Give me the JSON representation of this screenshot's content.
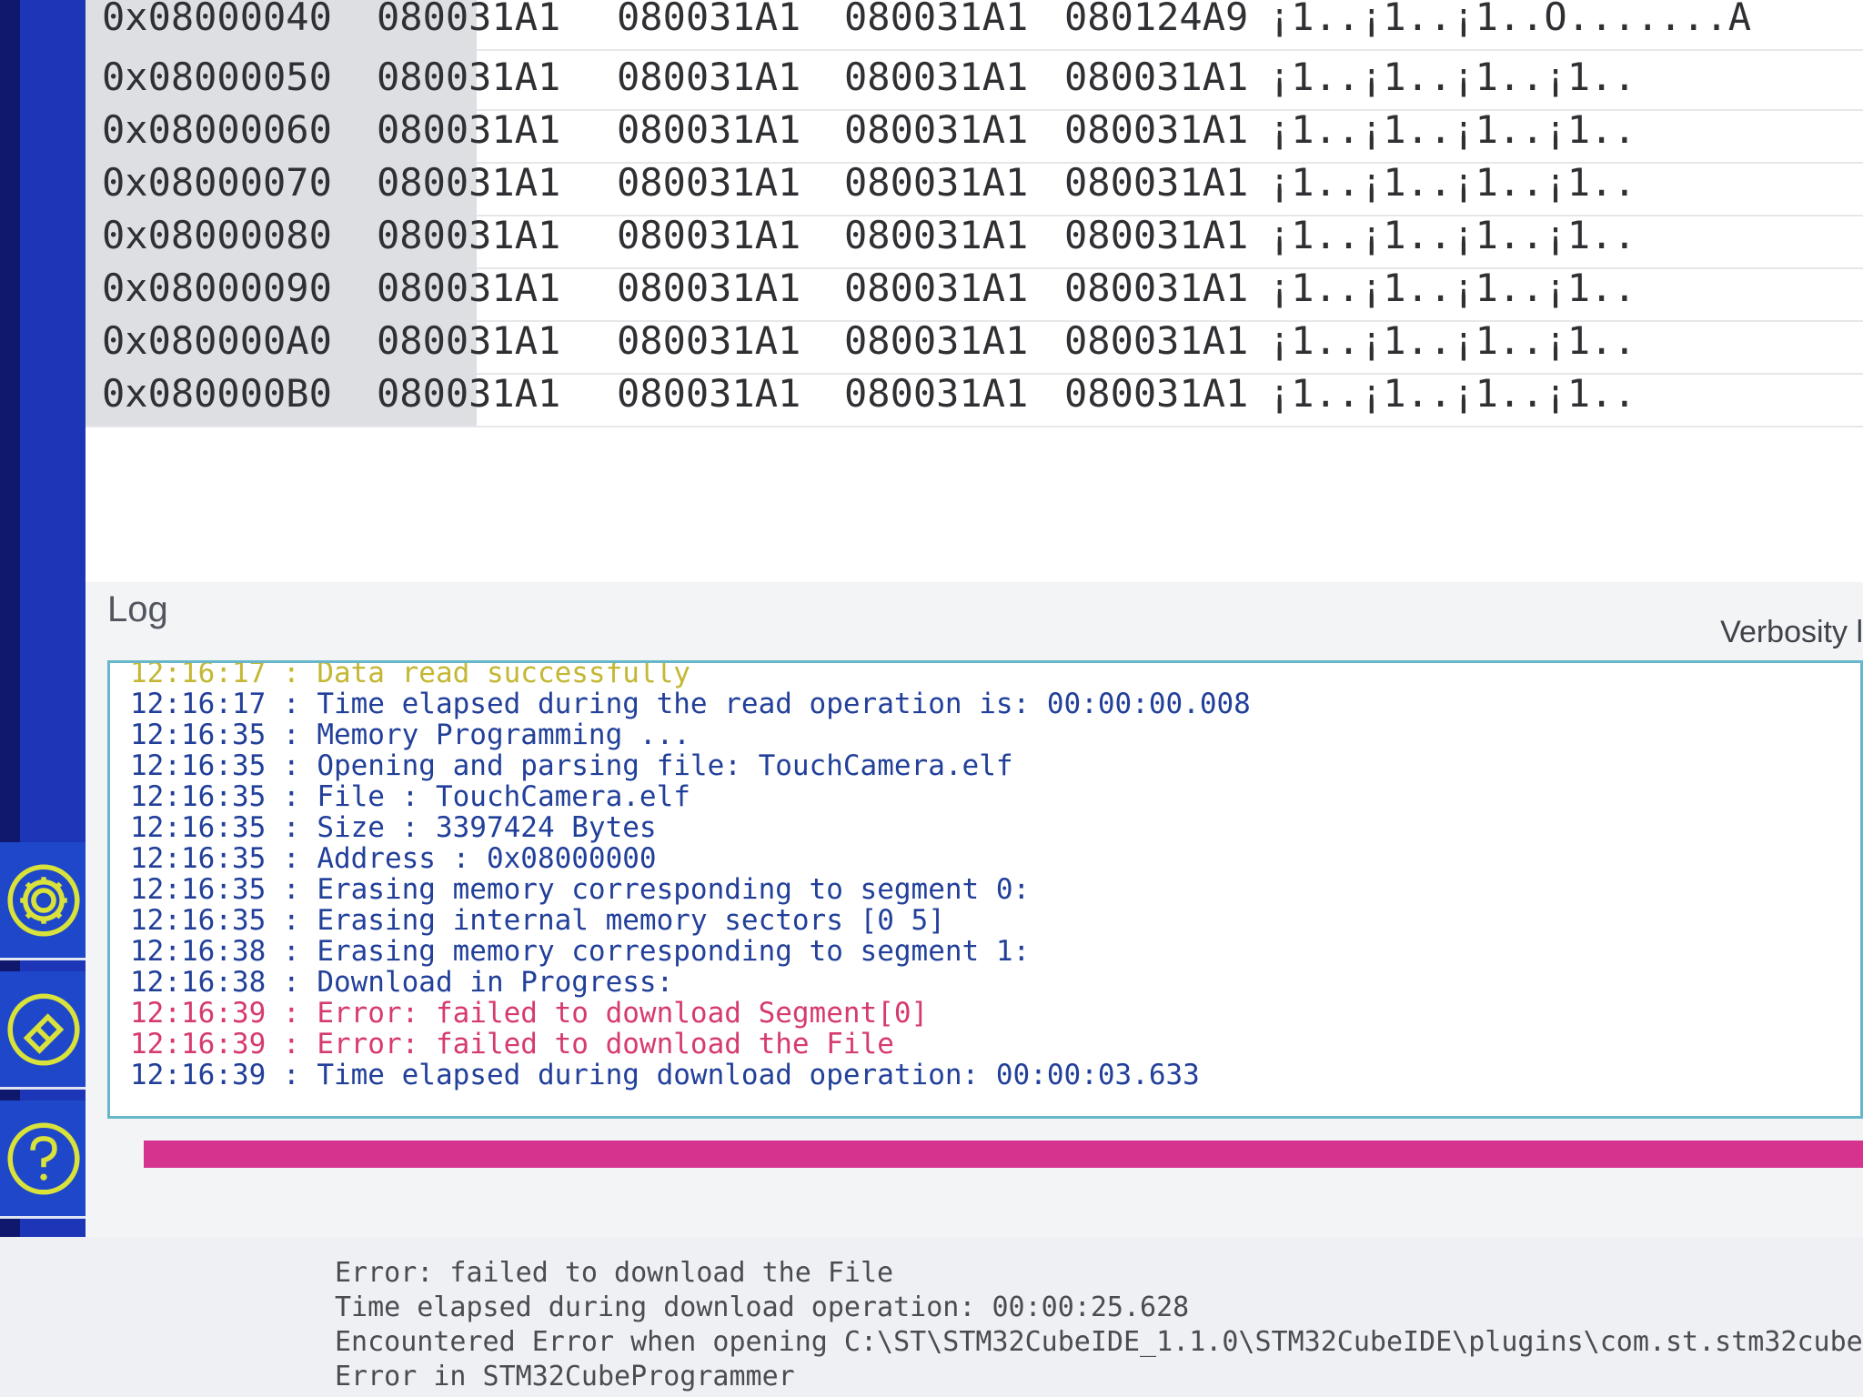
{
  "memory_table": {
    "rows": [
      {
        "address": "0x08000040",
        "words": [
          "080031A1",
          "080031A1",
          "080031A1",
          "080124A9"
        ],
        "ascii": "¡1..¡1..¡1..Ó.......A"
      },
      {
        "address": "0x08000050",
        "words": [
          "080031A1",
          "080031A1",
          "080031A1",
          "080031A1"
        ],
        "ascii": "¡1..¡1..¡1..¡1.."
      },
      {
        "address": "0x08000060",
        "words": [
          "080031A1",
          "080031A1",
          "080031A1",
          "080031A1"
        ],
        "ascii": "¡1..¡1..¡1..¡1.."
      },
      {
        "address": "0x08000070",
        "words": [
          "080031A1",
          "080031A1",
          "080031A1",
          "080031A1"
        ],
        "ascii": "¡1..¡1..¡1..¡1.."
      },
      {
        "address": "0x08000080",
        "words": [
          "080031A1",
          "080031A1",
          "080031A1",
          "080031A1"
        ],
        "ascii": "¡1..¡1..¡1..¡1.."
      },
      {
        "address": "0x08000090",
        "words": [
          "080031A1",
          "080031A1",
          "080031A1",
          "080031A1"
        ],
        "ascii": "¡1..¡1..¡1..¡1.."
      },
      {
        "address": "0x080000A0",
        "words": [
          "080031A1",
          "080031A1",
          "080031A1",
          "080031A1"
        ],
        "ascii": "¡1..¡1..¡1..¡1.."
      },
      {
        "address": "0x080000B0",
        "words": [
          "080031A1",
          "080031A1",
          "080031A1",
          "080031A1"
        ],
        "ascii": "¡1..¡1..¡1..¡1.."
      }
    ]
  },
  "log": {
    "title": "Log",
    "verbosity_label": "Verbosity l",
    "lines": [
      {
        "time": "12:16:17",
        "text": "Data read successfully",
        "level": "ok"
      },
      {
        "time": "12:16:17",
        "text": "Time elapsed during the read operation is: 00:00:00.008",
        "level": "info"
      },
      {
        "time": "12:16:35",
        "text": "Memory Programming ...",
        "level": "info"
      },
      {
        "time": "12:16:35",
        "text": "Opening and parsing file: TouchCamera.elf",
        "level": "info"
      },
      {
        "time": "12:16:35",
        "text": "File : TouchCamera.elf",
        "level": "info"
      },
      {
        "time": "12:16:35",
        "text": "Size : 3397424 Bytes",
        "level": "info"
      },
      {
        "time": "12:16:35",
        "text": "Address : 0x08000000",
        "level": "info"
      },
      {
        "time": "12:16:35",
        "text": "Erasing memory corresponding to segment 0:",
        "level": "info"
      },
      {
        "time": "12:16:35",
        "text": "Erasing internal memory sectors [0 5]",
        "level": "info"
      },
      {
        "time": "12:16:38",
        "text": "Erasing memory corresponding to segment 1:",
        "level": "info"
      },
      {
        "time": "12:16:38",
        "text": "Download in Progress:",
        "level": "info"
      },
      {
        "time": "12:16:39",
        "text": "Error: failed to download Segment[0]",
        "level": "err"
      },
      {
        "time": "12:16:39",
        "text": "Error: failed to download the File",
        "level": "err"
      },
      {
        "time": "12:16:39",
        "text": "Time elapsed during download operation: 00:00:03.633",
        "level": "info"
      }
    ]
  },
  "progress": {
    "value": 1.0,
    "color": "#d6338f"
  },
  "sidebar": {
    "icons": [
      {
        "name": "gear-icon"
      },
      {
        "name": "eraser-icon"
      },
      {
        "name": "help-icon"
      }
    ],
    "icon_color": "#d8e23a"
  },
  "console": {
    "lines": [
      "Error: failed to download the File",
      "Time elapsed during download operation: 00:00:25.628",
      "Encountered Error when opening C:\\ST\\STM32CubeIDE_1.1.0\\STM32CubeIDE\\plugins\\com.st.stm32cube",
      "Error in STM32CubeProgrammer"
    ]
  }
}
